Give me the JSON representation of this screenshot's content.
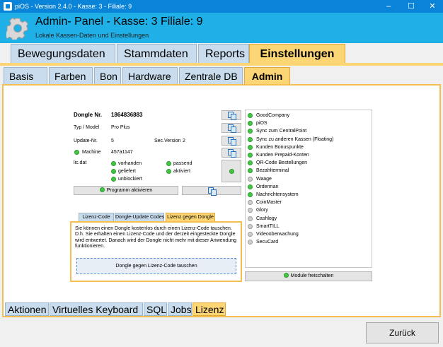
{
  "window": {
    "title": "piOS  -  Version 2.4.0  -  Kasse: 3  -  Filiale: 9"
  },
  "header": {
    "title": "Admin- Panel - Kasse: 3 Filiale: 9",
    "subtitle": "Lokale Kassen-Daten und Einstellungen"
  },
  "main_tabs": [
    "Bewegungsdaten",
    "Stammdaten",
    "Reports",
    "Einstellungen"
  ],
  "sub_tabs": [
    "Basis",
    "Farben",
    "Bon",
    "Hardware",
    "Zentrale DB",
    "Admin"
  ],
  "dongle": {
    "nr_label": "Dongle Nr.",
    "nr_value": "1864836883",
    "typ_label": "Typ / Model",
    "typ_value": "Pro Plus",
    "update_label": "Update-Nr.",
    "update_value": "5",
    "sec_label": "Sec.Version",
    "sec_value": "2",
    "machine_label": "Machine",
    "machine_value": "457a1147",
    "licdat_label": "lic.dat",
    "status": [
      "vorhanden",
      "passend",
      "geliefert",
      "aktiviert",
      "unblockiert"
    ],
    "program_button": "Programm aktivieren"
  },
  "modules": [
    {
      "name": "GoodCompany",
      "active": true
    },
    {
      "name": "piOS",
      "active": true
    },
    {
      "name": "Sync zum CentralPoint",
      "active": true
    },
    {
      "name": "Sync zu anderen Kassen (Floating)",
      "active": true
    },
    {
      "name": "Kunden Bonuspunkte",
      "active": true
    },
    {
      "name": "Kunden Prepaid-Konten",
      "active": true
    },
    {
      "name": "QR-Code Bestellungen",
      "active": true
    },
    {
      "name": "Bezahlterminal",
      "active": true
    },
    {
      "name": "Waage",
      "active": false
    },
    {
      "name": "Orderman",
      "active": true
    },
    {
      "name": "Nachrichtensystem",
      "active": true
    },
    {
      "name": "CoinMaster",
      "active": false
    },
    {
      "name": "Glory",
      "active": false
    },
    {
      "name": "Cashlogy",
      "active": false
    },
    {
      "name": "SmartTILL",
      "active": false
    },
    {
      "name": "Videoüberwachung",
      "active": false
    },
    {
      "name": "SecuCard",
      "active": false
    }
  ],
  "modules_button": "Module freischalten",
  "inner_tabs": [
    "Lizenz-Code",
    "Dongle-Update Codes",
    "Lizenz gegen Dongle"
  ],
  "inner_panel": {
    "text": "Sie können einen Dongle kostenlos durch einen Lizenz-Code tauschen. D.h. Sie erhalten einen Lizenz-Code und der derzeit eingesteckte Dongle wird entwertet. Danach wird der Dongle nicht mehr mit dieser Anwendung funktionieren.",
    "button": "Dongle gegen Lizenz-Code tauschen"
  },
  "bottom_tabs": [
    "Aktionen",
    "Virtuelles Keyboard",
    "SQL",
    "Jobs",
    "Lizenz"
  ],
  "footer": {
    "back_button": "Zurück"
  },
  "colors": {
    "titlebar": "#0a84d8",
    "header": "#20b0e8",
    "active_tab": "#fcd574",
    "tab": "#c8dcee"
  }
}
